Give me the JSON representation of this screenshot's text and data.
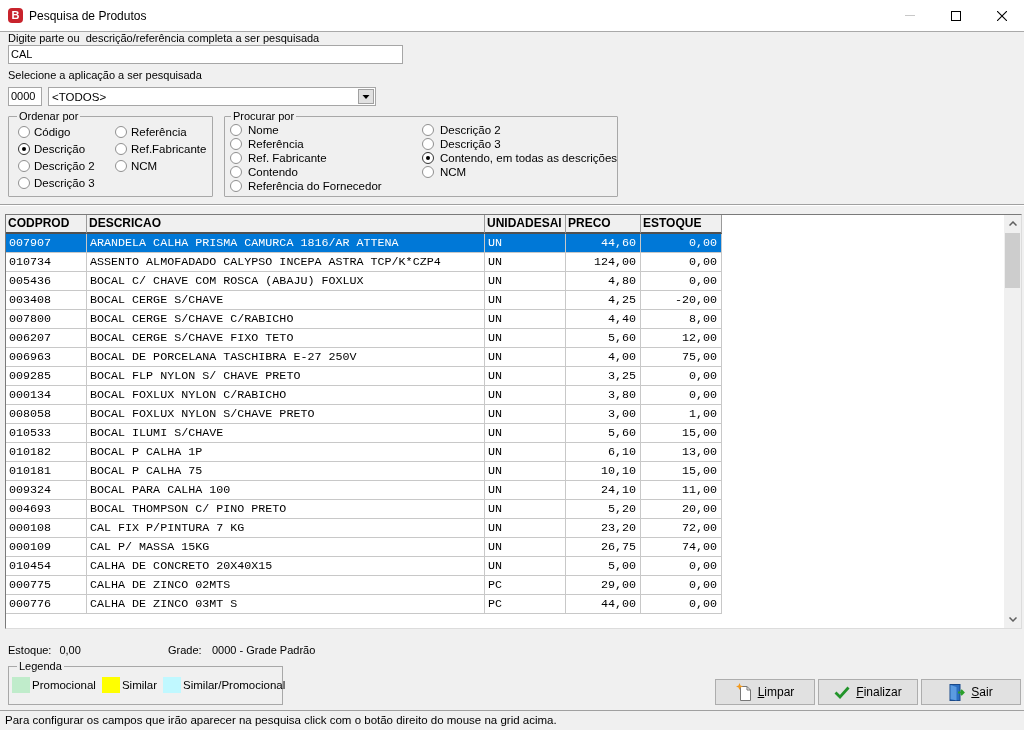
{
  "window": {
    "logo": "B",
    "title": "Pesquisa de Produtos",
    "controls": [
      {
        "kind": "minimize",
        "disabled": true
      },
      {
        "kind": "maximize",
        "disabled": false
      },
      {
        "kind": "close",
        "disabled": false
      }
    ]
  },
  "search": {
    "label": "Digite parte ou  descrição/referência completa a ser pesquisada",
    "value": "CAL"
  },
  "application": {
    "label": "Selecione a aplicação a ser pesquisada",
    "code": "0000",
    "value": "<TODOS>"
  },
  "order_by": {
    "title": "Ordenar por",
    "options": [
      {
        "label": "Código",
        "selected": false
      },
      {
        "label": "Descrição",
        "selected": true
      },
      {
        "label": "Descrição 2",
        "selected": false
      },
      {
        "label": "Descrição 3",
        "selected": false
      },
      {
        "label": "Referência",
        "selected": false
      },
      {
        "label": "Ref.Fabricante",
        "selected": false
      },
      {
        "label": "NCM",
        "selected": false
      }
    ]
  },
  "search_by": {
    "title": "Procurar por",
    "options": [
      {
        "label": "Nome",
        "selected": false
      },
      {
        "label": "Referência",
        "selected": false
      },
      {
        "label": "Ref. Fabricante",
        "selected": false
      },
      {
        "label": "Contendo",
        "selected": false
      },
      {
        "label": "Referência do Fornecedor",
        "selected": false
      },
      {
        "label": "Descrição 2",
        "selected": false
      },
      {
        "label": "Descrição 3",
        "selected": false
      },
      {
        "label": "Contendo, em todas as descrições",
        "selected": true
      },
      {
        "label": "NCM",
        "selected": false
      }
    ]
  },
  "table": {
    "columns": [
      "CODPROD",
      "DESCRICAO",
      "UNIDADESAI",
      "PRECO",
      "ESTOQUE"
    ],
    "rows": [
      {
        "selected": true,
        "cells": [
          "007907",
          "ARANDELA CALHA PRISMA CAMURCA 1816/AR ATTENA",
          "UN",
          "44,60",
          "0,00"
        ]
      },
      {
        "selected": false,
        "cells": [
          "010734",
          "ASSENTO ALMOFADADO CALYPSO INCEPA ASTRA TCP/K*CZP4",
          "UN",
          "124,00",
          "0,00"
        ]
      },
      {
        "selected": false,
        "cells": [
          "005436",
          "BOCAL C/ CHAVE COM ROSCA (ABAJU) FOXLUX",
          "UN",
          "4,80",
          "0,00"
        ]
      },
      {
        "selected": false,
        "cells": [
          "003408",
          "BOCAL CERGE S/CHAVE",
          "UN",
          "4,25",
          "-20,00"
        ]
      },
      {
        "selected": false,
        "cells": [
          "007800",
          "BOCAL CERGE S/CHAVE C/RABICHO",
          "UN",
          "4,40",
          "8,00"
        ]
      },
      {
        "selected": false,
        "cells": [
          "006207",
          "BOCAL CERGE S/CHAVE FIXO TETO",
          "UN",
          "5,60",
          "12,00"
        ]
      },
      {
        "selected": false,
        "cells": [
          "006963",
          "BOCAL DE PORCELANA TASCHIBRA E-27 250V",
          "UN",
          "4,00",
          "75,00"
        ]
      },
      {
        "selected": false,
        "cells": [
          "009285",
          "BOCAL FLP NYLON S/ CHAVE PRETO",
          "UN",
          "3,25",
          "0,00"
        ]
      },
      {
        "selected": false,
        "cells": [
          "000134",
          "BOCAL FOXLUX NYLON C/RABICHO",
          "UN",
          "3,80",
          "0,00"
        ]
      },
      {
        "selected": false,
        "cells": [
          "008058",
          "BOCAL FOXLUX NYLON S/CHAVE PRETO",
          "UN",
          "3,00",
          "1,00"
        ]
      },
      {
        "selected": false,
        "cells": [
          "010533",
          "BOCAL ILUMI S/CHAVE",
          "UN",
          "5,60",
          "15,00"
        ]
      },
      {
        "selected": false,
        "cells": [
          "010182",
          "BOCAL P CALHA 1P",
          "UN",
          "6,10",
          "13,00"
        ]
      },
      {
        "selected": false,
        "cells": [
          "010181",
          "BOCAL P CALHA 75",
          "UN",
          "10,10",
          "15,00"
        ]
      },
      {
        "selected": false,
        "cells": [
          "009324",
          "BOCAL PARA CALHA 100",
          "UN",
          "24,10",
          "11,00"
        ]
      },
      {
        "selected": false,
        "cells": [
          "004693",
          "BOCAL THOMPSON C/ PINO PRETO",
          "UN",
          "5,20",
          "20,00"
        ]
      },
      {
        "selected": false,
        "cells": [
          "000108",
          "CAL FIX P/PINTURA 7 KG",
          "UN",
          "23,20",
          "72,00"
        ]
      },
      {
        "selected": false,
        "cells": [
          "000109",
          "CAL P/ MASSA 15KG",
          "UN",
          "26,75",
          "74,00"
        ]
      },
      {
        "selected": false,
        "cells": [
          "010454",
          "CALHA DE CONCRETO 20X40X15",
          "UN",
          "5,00",
          "0,00"
        ]
      },
      {
        "selected": false,
        "cells": [
          "000775",
          "CALHA DE ZINCO 02MTS",
          "PC",
          "29,00",
          "0,00"
        ]
      },
      {
        "selected": false,
        "cells": [
          "000776",
          "CALHA DE ZINCO 03MT S",
          "PC",
          "44,00",
          "0,00"
        ]
      }
    ]
  },
  "summary": {
    "stock_label": "Estoque:",
    "stock_value": "0,00",
    "grade_label": "Grade:",
    "grade_value": "0000 - Grade Padrão"
  },
  "legend": {
    "title": "Legenda",
    "items": [
      {
        "label": "Promocional",
        "color": "#c0eccb"
      },
      {
        "label": "Similar",
        "color": "#ffff00"
      },
      {
        "label": "Similar/Promocional",
        "color": "#c0f8ff"
      }
    ]
  },
  "buttons": [
    {
      "kind": "clear",
      "label": "Limpar"
    },
    {
      "kind": "confirm",
      "label": "Finalizar"
    },
    {
      "kind": "exit",
      "label": "Sair"
    }
  ],
  "status_bar": "Para configurar os campos que irão aparecer na pesquisa click com o botão direito do mouse na grid acima."
}
